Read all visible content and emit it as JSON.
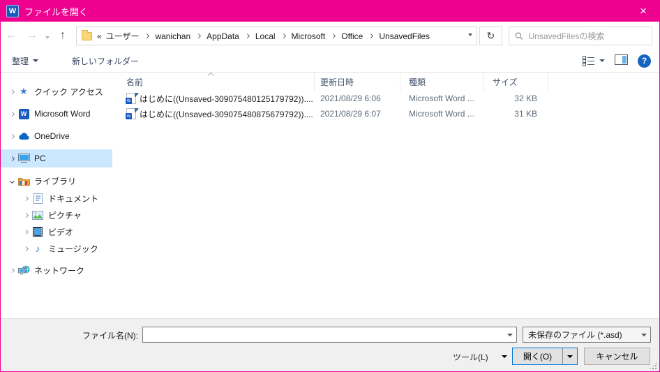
{
  "colors": {
    "titlebar_pink": "#ef0190",
    "accent_blue": "#0078d7",
    "selection_blue": "#cce8ff"
  },
  "window": {
    "title": "ファイルを開く"
  },
  "icons": {
    "close": "×",
    "back": "←",
    "forward": "→",
    "up": "↑",
    "refresh": "↻",
    "overflow": "«",
    "word_letter": "W",
    "word_letter_small": "w",
    "help": "?",
    "music_note": "♪",
    "star": "★"
  },
  "address_bar": {
    "crumbs": [
      "ユーザー",
      "wanichan",
      "AppData",
      "Local",
      "Microsoft",
      "Office",
      "UnsavedFiles"
    ],
    "search_placeholder": "UnsavedFilesの検索"
  },
  "toolbar": {
    "organize": "整理",
    "new_folder": "新しいフォルダー"
  },
  "sidebar": {
    "items": [
      {
        "label": "クイック アクセス"
      },
      {
        "label": "Microsoft Word"
      },
      {
        "label": "OneDrive"
      },
      {
        "label": "PC"
      },
      {
        "label": "ライブラリ"
      },
      {
        "label": "ドキュメント"
      },
      {
        "label": "ピクチャ"
      },
      {
        "label": "ビデオ"
      },
      {
        "label": "ミュージック"
      },
      {
        "label": "ネットワーク"
      }
    ]
  },
  "list": {
    "columns": [
      "名前",
      "更新日時",
      "種類",
      "サイズ"
    ],
    "rows": [
      {
        "name": "はじめに((Unsaved-309075480125179792))....",
        "date": "2021/08/29 6:06",
        "type": "Microsoft Word ...",
        "size": "32 KB"
      },
      {
        "name": "はじめに((Unsaved-309075480875679792))....",
        "date": "2021/08/29 6:07",
        "type": "Microsoft Word ...",
        "size": "31 KB"
      }
    ]
  },
  "footer": {
    "filename_label": "ファイル名(N):",
    "filename_value": "",
    "filetype_value": "未保存のファイル (*.asd)",
    "tools": "ツール(L)",
    "open": "開く(O)",
    "cancel": "キャンセル"
  }
}
